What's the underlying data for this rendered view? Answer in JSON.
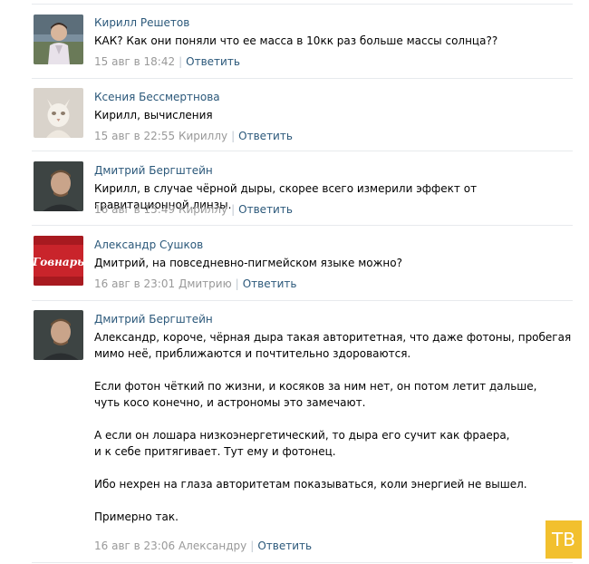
{
  "comments": [
    {
      "author": "Кирилл Решетов",
      "paragraphs": [
        "КАК? Как они поняли что ее масса в 10кк раз больше массы солнца??"
      ],
      "time": "15 авг в 18:42",
      "reply_to": "",
      "reply_label": "Ответить"
    },
    {
      "author": "Ксения Бессмертнова",
      "paragraphs": [
        "Кирилл, вычисления"
      ],
      "time": "15 авг в 22:55",
      "reply_to": "Кириллу",
      "reply_label": "Ответить"
    },
    {
      "author": "Дмитрий Бергштейн",
      "paragraphs": [
        "Кирилл, в случае чёрной дыры, скорее всего измерили эффект от гравитационной линзы."
      ],
      "time": "16 авг в 15:49",
      "reply_to": "Кириллу",
      "reply_label": "Ответить"
    },
    {
      "author": "Александр Сушков",
      "avatar_text": "Говнарь",
      "paragraphs": [
        "Дмитрий, на повседневно-пигмейском языке можно?"
      ],
      "time": "16 авг в 23:01",
      "reply_to": "Дмитрию",
      "reply_label": "Ответить"
    },
    {
      "author": "Дмитрий Бергштейн",
      "paragraphs": [
        "Александр, короче, чёрная дыра такая авторитетная, что даже фотоны, пробегая мимо неё, приближаются и почтительно здороваются.",
        "Если фотон чёткий по жизни, и косяков за ним нет, он потом летит дальше, чуть косо конечно, и астрономы это замечают.",
        "А если он лошара низкоэнергетический, то дыра его сучит как фраера, и к себе притягивает. Тут ему и фотонец.",
        "Ибо нехрен на глаза авторитетам показываться, коли энергией не вышел.",
        "Примерно так."
      ],
      "time": "16 авг в 23:06",
      "reply_to": "Александру",
      "reply_label": "Ответить"
    }
  ],
  "watermark": "ТВ",
  "colors": {
    "author_link": "#2b587a",
    "meta_gray": "#999999",
    "divider": "#e7eaed",
    "watermark_bg": "#f2c02e"
  }
}
